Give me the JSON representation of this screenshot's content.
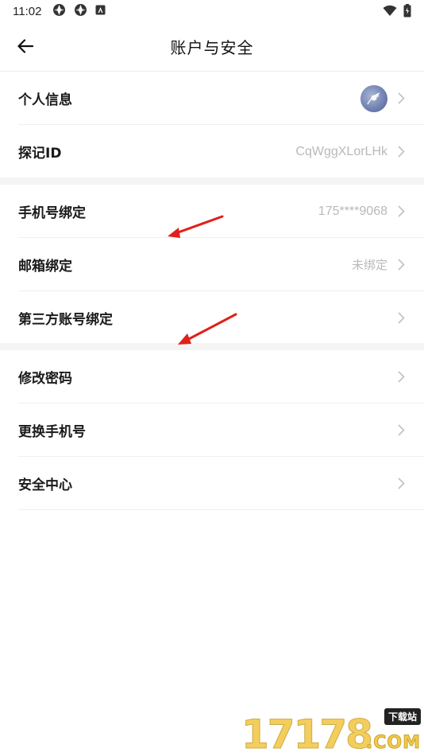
{
  "status_bar": {
    "time": "11:02"
  },
  "header": {
    "title": "账户与安全"
  },
  "sections": [
    {
      "rows": [
        {
          "label": "个人信息",
          "value": "",
          "has_avatar": true
        },
        {
          "label": "探记ID",
          "value": "CqWggXLorLHk"
        }
      ]
    },
    {
      "rows": [
        {
          "label": "手机号绑定",
          "value": "175****9068"
        },
        {
          "label": "邮箱绑定",
          "value": "未绑定"
        },
        {
          "label": "第三方账号绑定",
          "value": ""
        }
      ]
    },
    {
      "rows": [
        {
          "label": "修改密码",
          "value": ""
        },
        {
          "label": "更换手机号",
          "value": ""
        },
        {
          "label": "安全中心",
          "value": ""
        }
      ]
    }
  ],
  "watermark": {
    "digits": "17178",
    "badge": "下载站",
    "domain": ".COM"
  },
  "colors": {
    "annotation_arrow": "#e0201a",
    "chevron": "#c4c4c4",
    "value_text": "#b9b9b9",
    "section_gap": "#f4f4f4"
  }
}
